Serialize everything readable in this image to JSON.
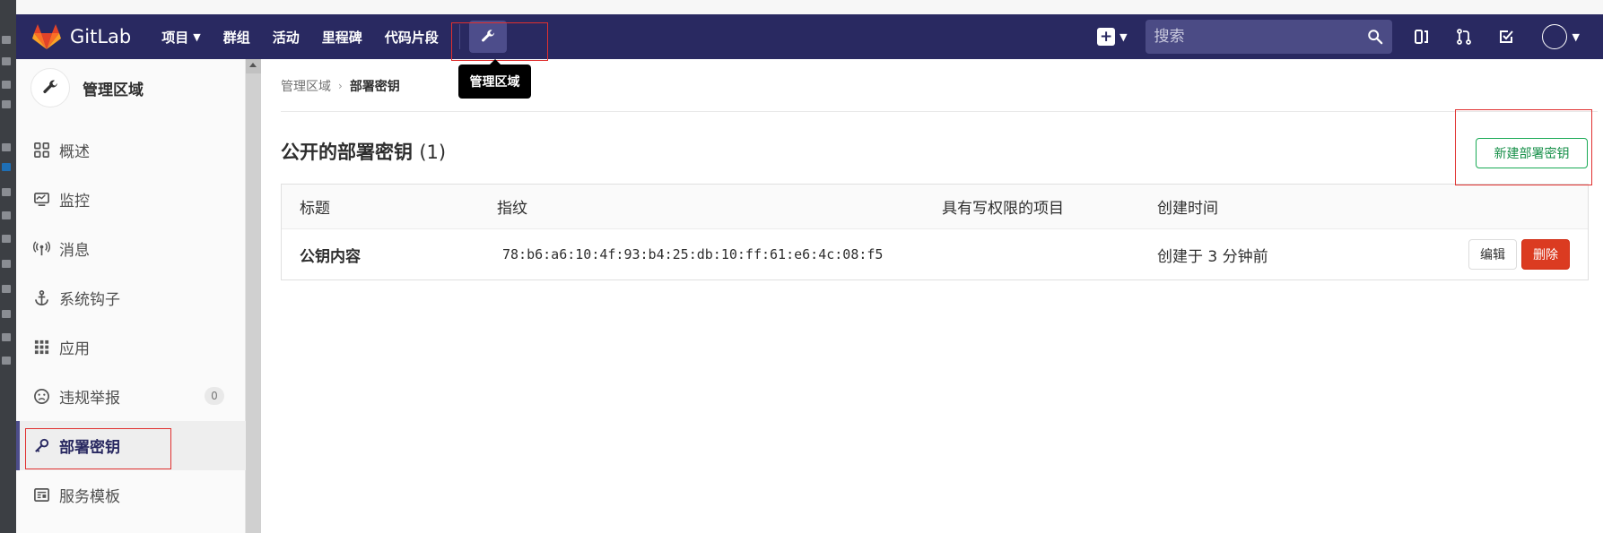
{
  "colors": {
    "header_bg": "#292961",
    "sidebar_active": "#292961",
    "new_button": "#1aaa55",
    "delete_button": "#db3b21",
    "highlight_box": "#e0302f"
  },
  "header": {
    "logo_text": "GitLab",
    "nav": [
      {
        "label": "项目",
        "has_dropdown": true
      },
      {
        "label": "群组"
      },
      {
        "label": "活动"
      },
      {
        "label": "里程碑"
      },
      {
        "label": "代码片段"
      }
    ],
    "admin_icon": "wrench-icon",
    "search_placeholder": "搜索",
    "right_icons": [
      "plus-square-icon",
      "search-icon",
      "issues-icon",
      "merge-request-icon",
      "todo-icon",
      "avatar"
    ]
  },
  "tooltip": {
    "text": "管理区域"
  },
  "sidebar": {
    "title": "管理区域",
    "items": [
      {
        "label": "概述",
        "icon": "overview-grid-icon"
      },
      {
        "label": "监控",
        "icon": "monitor-icon"
      },
      {
        "label": "消息",
        "icon": "broadcast-icon"
      },
      {
        "label": "系统钩子",
        "icon": "anchor-icon"
      },
      {
        "label": "应用",
        "icon": "apps-grid-icon"
      },
      {
        "label": "违规举报",
        "icon": "smiley-icon",
        "badge": "0"
      },
      {
        "label": "部署密钥",
        "icon": "key-icon",
        "active": true
      },
      {
        "label": "服务模板",
        "icon": "template-icon"
      }
    ]
  },
  "breadcrumb": {
    "root": "管理区域",
    "sep": "›",
    "current": "部署密钥"
  },
  "page": {
    "title": "公开的部署密钥",
    "count": "(1)",
    "new_button": "新建部署密钥"
  },
  "table": {
    "headers": [
      "标题",
      "指纹",
      "具有写权限的项目",
      "创建时间"
    ],
    "rows": [
      {
        "title": "公钥内容",
        "fingerprint": "78:b6:a6:10:4f:93:b4:25:db:10:ff:61:e6:4c:08:f5",
        "projects": "",
        "created": "创建于 3 分钟前",
        "edit_label": "编辑",
        "delete_label": "删除"
      }
    ]
  }
}
